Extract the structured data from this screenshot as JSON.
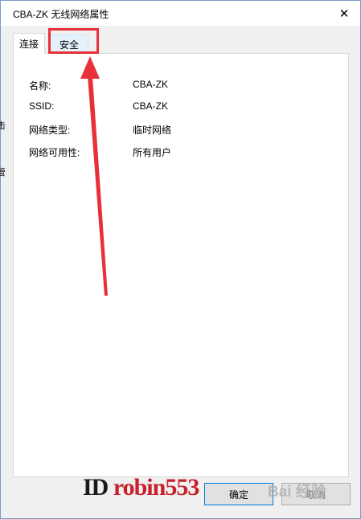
{
  "window": {
    "title": "CBA-ZK 无线网络属性",
    "close_glyph": "✕"
  },
  "tabs": [
    {
      "label": "连接",
      "active": true
    },
    {
      "label": "安全",
      "active": false
    }
  ],
  "properties": [
    {
      "label": "名称:",
      "value": "CBA-ZK"
    },
    {
      "label": "SSID:",
      "value": "CBA-ZK"
    },
    {
      "label": "网络类型:",
      "value": "临时网络"
    },
    {
      "label": "网络可用性:",
      "value": "所有用户"
    }
  ],
  "buttons": {
    "ok": "确定",
    "cancel": "取消"
  },
  "background_fragments": [
    "击",
    "管"
  ],
  "annotation": {
    "color": "#e8303a"
  },
  "watermark": {
    "id_prefix": "ID ",
    "id_name": "robin553",
    "site": "Bai 经验"
  },
  "colors": {
    "accent": "#0078d7",
    "annotation_red": "#e8303a"
  }
}
